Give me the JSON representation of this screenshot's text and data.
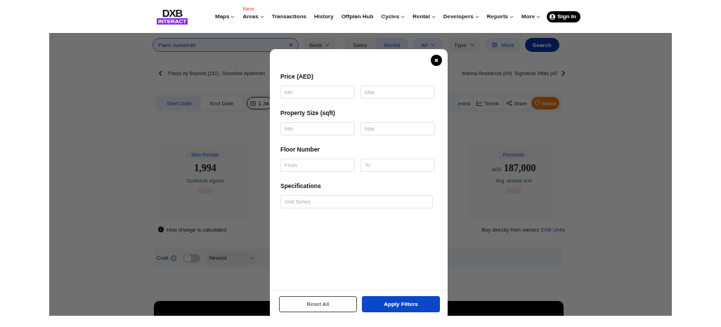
{
  "header": {
    "logo": {
      "text": "DXB",
      "subtext": "INTERACT"
    },
    "nav": [
      {
        "label": "Maps",
        "dropdown": true
      },
      {
        "label": "Areas",
        "dropdown": true,
        "badge": "New"
      },
      {
        "label": "Transactions",
        "dropdown": false
      },
      {
        "label": "History",
        "dropdown": false
      },
      {
        "label": "Offplan Hub",
        "dropdown": false
      },
      {
        "label": "Cycles",
        "dropdown": true
      },
      {
        "label": "Rental",
        "dropdown": true
      },
      {
        "label": "Developers",
        "dropdown": true
      },
      {
        "label": "Reports",
        "dropdown": true
      },
      {
        "label": "More",
        "dropdown": true
      }
    ],
    "sign_in": "Sign In"
  },
  "search": {
    "value": "Palm Jumeirah",
    "beds": "Beds",
    "modes": [
      {
        "label": "Sales",
        "selected": false
      },
      {
        "label": "Rental",
        "selected": true
      }
    ],
    "status": "All",
    "type": "Type",
    "more": "More",
    "button": "Search"
  },
  "chips_left": [
    "Passo by Beyond (151)",
    "Shoreline Apartmen"
  ],
  "chips_right": [
    "Marina Residence (49)",
    "Signature Villas (42"
  ],
  "toolbar": {
    "date_tabs": [
      {
        "label": "Start Date",
        "selected": true
      },
      {
        "label": "End Date",
        "selected": false
      }
    ],
    "date_value": "1 Ja",
    "actions": [
      {
        "kind": "plain",
        "label": "ented"
      },
      {
        "kind": "trends",
        "label": "Trends"
      },
      {
        "kind": "share",
        "label": "Share"
      },
      {
        "kind": "advice",
        "label": "Advice"
      }
    ]
  },
  "cards": [
    {
      "kind": "new",
      "tag": "New Rentals",
      "value": "1,994",
      "caption": "Contracts signed"
    },
    {
      "kind": "renewal",
      "tag": "Renewals",
      "unit": "AED",
      "value": "187,000",
      "caption": "Avg. annual rent"
    }
  ],
  "info": "How change is calculated",
  "promo": {
    "text": "Buy directly from owners",
    "link": "DXB Units"
  },
  "controls": {
    "cost_label": "Cost",
    "cost_on": false,
    "sort": "Newest"
  },
  "modal": {
    "sections": [
      {
        "label": "Price (AED)",
        "fields": [
          {
            "placeholder": "Min"
          },
          {
            "placeholder": "Max"
          }
        ]
      },
      {
        "label": "Property Size (sqft)",
        "fields": [
          {
            "placeholder": "Min"
          },
          {
            "placeholder": "Max"
          }
        ]
      },
      {
        "label": "Floor Number",
        "fields": [
          {
            "placeholder": "From"
          },
          {
            "placeholder": "To"
          }
        ]
      },
      {
        "label": "Specifications",
        "fields": [
          {
            "placeholder": "Unit Series"
          }
        ]
      }
    ],
    "reset": "Reset All",
    "apply": "Apply Filters"
  }
}
